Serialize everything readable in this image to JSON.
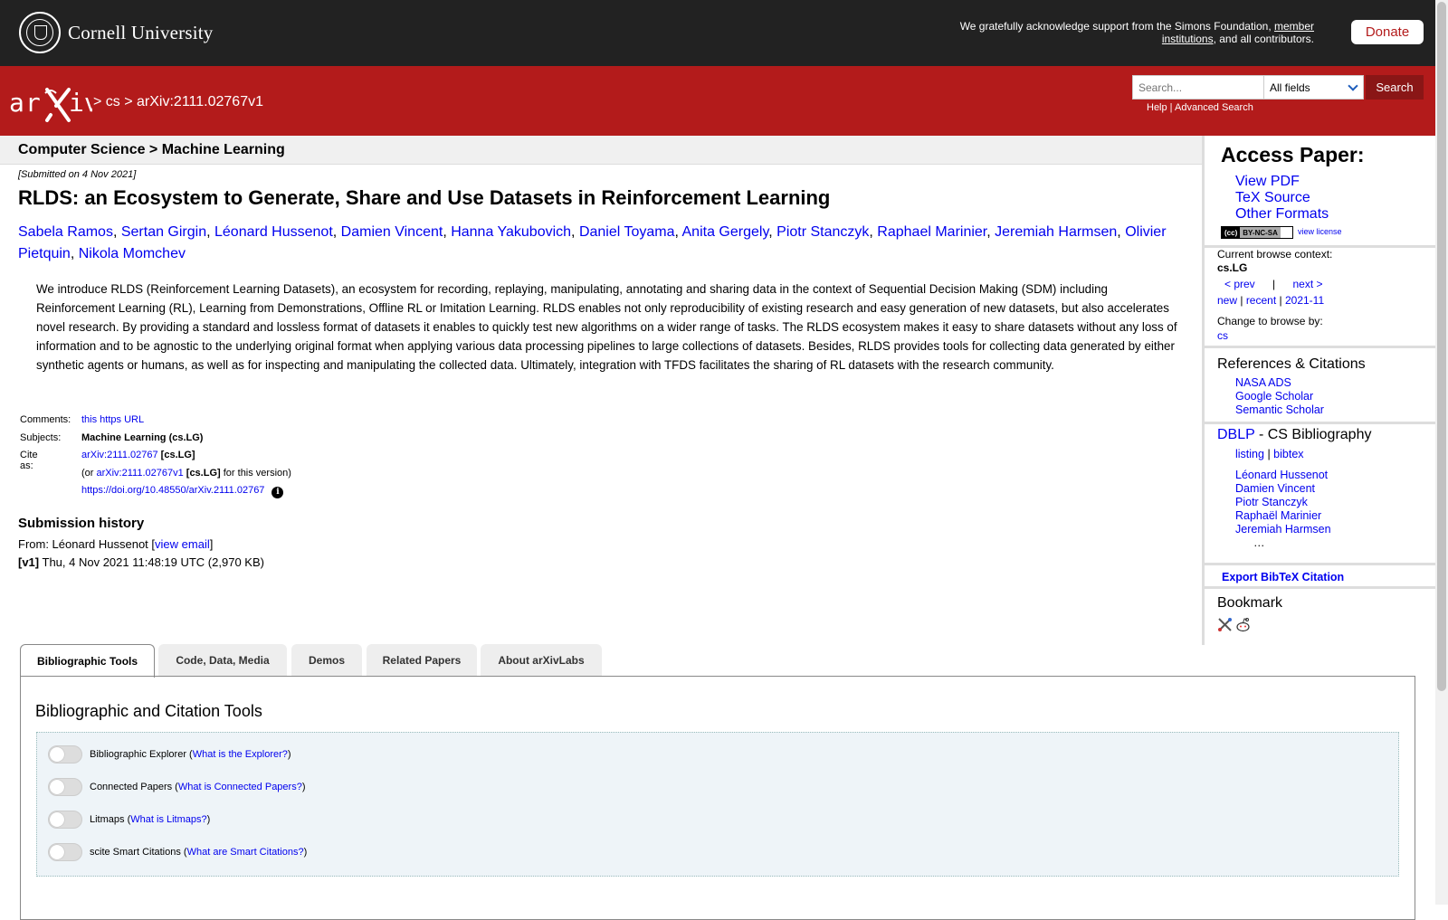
{
  "cornell": {
    "name": "Cornell University"
  },
  "support": {
    "text_before": "We gratefully acknowledge support from the Simons Foundation, ",
    "member_link": "member institutions",
    "text_after": ", and all contributors."
  },
  "donate": "Donate",
  "breadcrumb": {
    "sep1": " > ",
    "cs": "cs",
    "sep2": " > ",
    "id": "arXiv:2111.02767v1"
  },
  "search": {
    "placeholder": "Search...",
    "field": "All fields",
    "button": "Search",
    "help": "Help",
    "sep": " | ",
    "advanced": "Advanced Search"
  },
  "category": "Computer Science > Machine Learning",
  "submitted": "[Submitted on 4 Nov 2021]",
  "title": "RLDS: an Ecosystem to Generate, Share and Use Datasets in Reinforcement Learning",
  "authors": [
    "Sabela Ramos",
    "Sertan Girgin",
    "Léonard Hussenot",
    "Damien Vincent",
    "Hanna Yakubovich",
    "Daniel Toyama",
    "Anita Gergely",
    "Piotr Stanczyk",
    "Raphael Marinier",
    "Jeremiah Harmsen",
    "Olivier Pietquin",
    "Nikola Momchev"
  ],
  "abstract": "We introduce RLDS (Reinforcement Learning Datasets), an ecosystem for recording, replaying, manipulating, annotating and sharing data in the context of Sequential Decision Making (SDM) including Reinforcement Learning (RL), Learning from Demonstrations, Offline RL or Imitation Learning. RLDS enables not only reproducibility of existing research and easy generation of new datasets, but also accelerates novel research. By providing a standard and lossless format of datasets it enables to quickly test new algorithms on a wider range of tasks. The RLDS ecosystem makes it easy to share datasets without any loss of information and to be agnostic to the underlying original format when applying various data processing pipelines to large collections of datasets. Besides, RLDS provides tools for collecting data generated by either synthetic agents or humans, as well as for inspecting and manipulating the collected data. Ultimately, integration with TFDS facilitates the sharing of RL datasets with the research community.",
  "meta": {
    "comments_label": "Comments:",
    "comments_link": "this https URL",
    "subjects_label": "Subjects:",
    "subjects": "Machine Learning (cs.LG)",
    "cite_label": "Cite as:",
    "cite_id": "arXiv:2111.02767",
    "cite_cat": "[cs.LG]",
    "or_prefix": "(or ",
    "version_id": "arXiv:2111.02767v1",
    "version_cat": "[cs.LG]",
    "version_suffix": " for this version)",
    "doi": "https://doi.org/10.48550/arXiv.2111.02767",
    "info_glyph": "i"
  },
  "history": {
    "title": "Submission history",
    "from_prefix": "From: Léonard Hussenot [",
    "view_email": "view email",
    "from_suffix": "]",
    "v1_label": "[v1]",
    "v1_text": " Thu, 4 Nov 2021 11:48:19 UTC (2,970 KB)"
  },
  "sidebar": {
    "access_title": "Access Paper:",
    "access_links": [
      "View PDF",
      "TeX Source",
      "Other Formats"
    ],
    "cc_left": "(cc)",
    "cc_right": "BY-NC-SA",
    "view_license": "view license",
    "browse_context_label": "Current browse context:",
    "browse_context": "cs.LG",
    "prev": "< prev",
    "bar": "|",
    "next": "next >",
    "new": "new",
    "recent": "recent",
    "month": "2021-11",
    "change_label": "Change to browse by:",
    "change_cs": "cs",
    "refs_title": "References & Citations",
    "refs": [
      "NASA ADS",
      "Google Scholar",
      "Semantic Scholar"
    ],
    "dblp": "DBLP",
    "dblp_suffix": " - CS Bibliography",
    "listing": "listing",
    "bibtex": "bibtex",
    "dblp_authors": [
      "Léonard Hussenot",
      "Damien Vincent",
      "Piotr Stanczyk",
      "Raphaël Marinier",
      "Jeremiah Harmsen"
    ],
    "ellipsis": "…",
    "export": "Export BibTeX Citation",
    "bookmark": "Bookmark"
  },
  "tabs": [
    "Bibliographic Tools",
    "Code, Data, Media",
    "Demos",
    "Related Papers",
    "About arXivLabs"
  ],
  "panel": {
    "title": "Bibliographic and Citation Tools",
    "tools": [
      {
        "name": "Bibliographic Explorer",
        "link": "What is the Explorer?"
      },
      {
        "name": "Connected Papers",
        "link": "What is Connected Papers?"
      },
      {
        "name": "Litmaps",
        "link": "What is Litmaps?"
      },
      {
        "name": "scite Smart Citations",
        "link": "What are Smart Citations?"
      }
    ]
  }
}
